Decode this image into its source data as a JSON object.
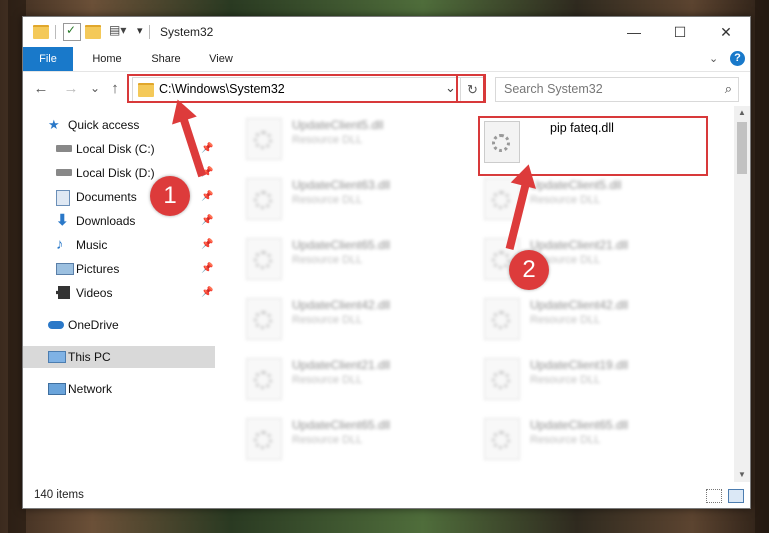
{
  "window": {
    "title": "System32",
    "controls": {
      "minimize": "—",
      "maximize": "☐",
      "close": "✕"
    }
  },
  "ribbon": {
    "tabs": [
      "File",
      "Home",
      "Share",
      "View"
    ],
    "help": "?"
  },
  "navigation": {
    "back": "←",
    "forward": "→",
    "recent": "⌄",
    "up": "↑",
    "address": "C:\\Windows\\System32",
    "refresh": "↻",
    "dropdown": "⌄",
    "search_placeholder": "Search System32",
    "search_icon": "⌕"
  },
  "sidebar": {
    "items": [
      {
        "label": "Quick access",
        "icon": "star-icon",
        "pinned": false
      },
      {
        "label": "Local Disk (C:)",
        "icon": "drive-icon",
        "pinned": true
      },
      {
        "label": "Local Disk (D:)",
        "icon": "drive-icon",
        "pinned": true
      },
      {
        "label": "Documents",
        "icon": "documents-icon",
        "pinned": true
      },
      {
        "label": "Downloads",
        "icon": "download-icon",
        "pinned": true
      },
      {
        "label": "Music",
        "icon": "music-icon",
        "pinned": true
      },
      {
        "label": "Pictures",
        "icon": "pictures-icon",
        "pinned": true
      },
      {
        "label": "Videos",
        "icon": "videos-icon",
        "pinned": true
      },
      {
        "label": "OneDrive",
        "icon": "cloud-icon",
        "pinned": false
      },
      {
        "label": "This PC",
        "icon": "pc-icon",
        "pinned": false,
        "selected": true
      },
      {
        "label": "Network",
        "icon": "network-icon",
        "pinned": false
      }
    ]
  },
  "files": {
    "left_column": [
      {
        "name": "UpdateClient5.dll",
        "type": "Resource DLL"
      },
      {
        "name": "UpdateClient63.dll",
        "type": "Resource DLL"
      },
      {
        "name": "UpdateClient65.dll",
        "type": "Resource DLL"
      },
      {
        "name": "UpdateClient42.dll",
        "type": "Resource DLL"
      },
      {
        "name": "UpdateClient21.dll",
        "type": "Resource DLL"
      },
      {
        "name": "UpdateClient65.dll",
        "type": "Resource DLL"
      }
    ],
    "right_column": [
      {
        "name": "UpdateClient5.dll",
        "type": "Resource DLL"
      },
      {
        "name": "UpdateClient21.dll",
        "type": "Resource DLL"
      },
      {
        "name": "UpdateClient42.dll",
        "type": "Resource DLL"
      },
      {
        "name": "UpdateClient19.dll",
        "type": "Resource DLL"
      },
      {
        "name": "UpdateClient65.dll",
        "type": "Resource DLL"
      }
    ],
    "highlighted": {
      "name": "pip fateq.dll"
    }
  },
  "status": {
    "item_count": "140 items"
  },
  "annotations": {
    "marker1": "1",
    "marker2": "2",
    "color": "#dd3b3b"
  }
}
